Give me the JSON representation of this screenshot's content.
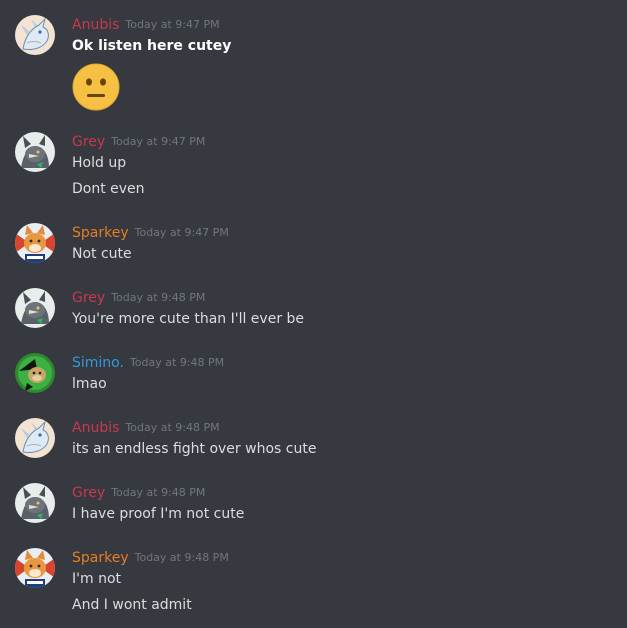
{
  "colors": {
    "background": "#36393f",
    "timestamp": "#72767d",
    "text": "#dcddde",
    "anubis": "#c8384f",
    "grey": "#c8384f",
    "sparkey": "#e67e22",
    "simino": "#3498db"
  },
  "messages": [
    {
      "author": "Anubis",
      "timestamp": "Today at 9:47 PM",
      "avatar_icon": "white-dragon-avatar-icon",
      "lines": [
        "Ok listen here cutey"
      ],
      "emoji": "neutral-face-emoji-icon"
    },
    {
      "author": "Grey",
      "timestamp": "Today at 9:47 PM",
      "avatar_icon": "grey-wolf-avatar-icon",
      "lines": [
        "Hold up",
        "Dont even"
      ]
    },
    {
      "author": "Sparkey",
      "timestamp": "Today at 9:47 PM",
      "avatar_icon": "orange-fox-avatar-icon",
      "lines": [
        "Not cute"
      ]
    },
    {
      "author": "Grey",
      "timestamp": "Today at 9:48 PM",
      "avatar_icon": "grey-wolf-avatar-icon",
      "lines": [
        "You're more cute than I'll ever be"
      ]
    },
    {
      "author": "Simino.",
      "timestamp": "Today at 9:48 PM",
      "avatar_icon": "green-monkey-avatar-icon",
      "lines": [
        "lmao"
      ]
    },
    {
      "author": "Anubis",
      "timestamp": "Today at 9:48 PM",
      "avatar_icon": "white-dragon-avatar-icon",
      "lines": [
        "its an endless fight over whos cute"
      ]
    },
    {
      "author": "Grey",
      "timestamp": "Today at 9:48 PM",
      "avatar_icon": "grey-wolf-avatar-icon",
      "lines": [
        "I have proof I'm not cute"
      ]
    },
    {
      "author": "Sparkey",
      "timestamp": "Today at 9:48 PM",
      "avatar_icon": "orange-fox-avatar-icon",
      "lines": [
        "I'm not",
        "And I wont admit"
      ]
    }
  ]
}
